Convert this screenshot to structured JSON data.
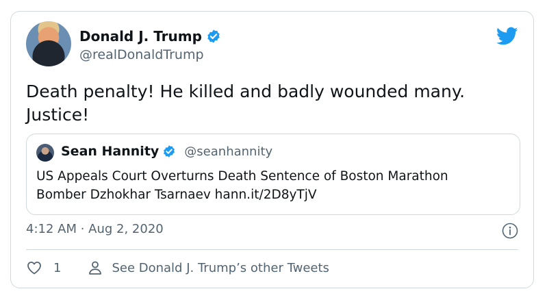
{
  "tweet": {
    "author_name": "Donald J. Trump",
    "author_handle": "@realDonaldTrump",
    "text_line1": "Death penalty! He killed and badly wounded many.",
    "text_line2": "Justice!",
    "timestamp": "4:12 AM · Aug 2, 2020",
    "likes": "1",
    "see_more": "See Donald J. Trump’s other Tweets"
  },
  "quoted": {
    "author_name": "Sean Hannity",
    "author_handle": "@seanhannity",
    "text_line1": "US Appeals Court Overturns Death Sentence of Boston Marathon",
    "text_line2": "Bomber Dzhokhar Tsarnaev hann.it/2D8yTjV"
  },
  "colors": {
    "brand": "#1d9bf0",
    "text": "#0f1419",
    "secondary": "#536471",
    "border": "#cfd9de"
  },
  "icons": [
    "verified-badge-icon",
    "twitter-bird-icon",
    "info-icon",
    "heart-icon",
    "person-icon"
  ]
}
